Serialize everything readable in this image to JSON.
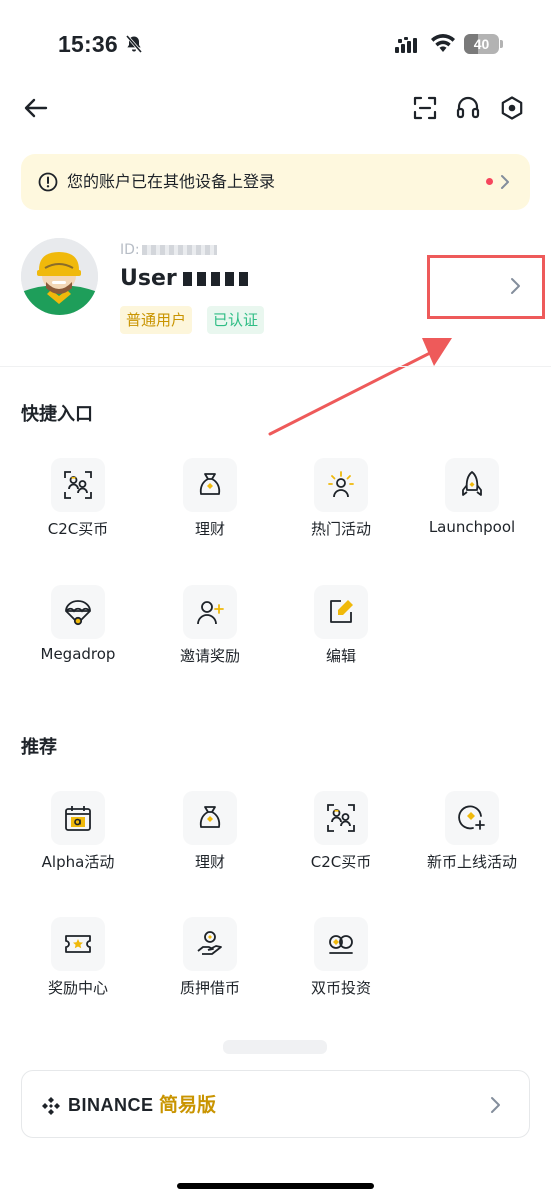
{
  "status_bar": {
    "time": "15:36",
    "battery": "40",
    "battery_level": 0.4
  },
  "header": {
    "back_icon": "arrow-left-icon",
    "scan_icon": "scan-icon",
    "support_icon": "headset-icon",
    "settings_icon": "settings-hexagon-icon"
  },
  "notice": {
    "text": "您的账户已在其他设备上登录"
  },
  "profile": {
    "id_prefix": "ID:",
    "username_prefix": "User",
    "badge_normal": "普通用户",
    "badge_verified": "已认证"
  },
  "quick_access": {
    "title": "快捷入口",
    "items": [
      {
        "label": "C2C买币",
        "icon": "c2c-users-icon"
      },
      {
        "label": "理财",
        "icon": "money-bag-icon"
      },
      {
        "label": "热门活动",
        "icon": "sun-person-icon"
      },
      {
        "label": "Launchpool",
        "icon": "rocket-icon"
      },
      {
        "label": "Megadrop",
        "icon": "parachute-icon"
      },
      {
        "label": "邀请奖励",
        "icon": "add-user-icon"
      },
      {
        "label": "编辑",
        "icon": "edit-icon"
      }
    ]
  },
  "recommended": {
    "title": "推荐",
    "items": [
      {
        "label": "Alpha活动",
        "icon": "calendar-alpha-icon"
      },
      {
        "label": "理财",
        "icon": "money-bag-icon"
      },
      {
        "label": "C2C买币",
        "icon": "c2c-users-icon"
      },
      {
        "label": "新币上线活动",
        "icon": "new-coin-icon"
      },
      {
        "label": "奖励中心",
        "icon": "ticket-star-icon"
      },
      {
        "label": "质押借币",
        "icon": "hand-coin-icon"
      },
      {
        "label": "双币投资",
        "icon": "dual-coin-icon"
      }
    ]
  },
  "lite": {
    "brand": "BINANCE",
    "subtitle": "简易版"
  },
  "colors": {
    "accent": "#c99400",
    "yellow": "#f0b90b",
    "notice_bg": "#fef8de",
    "verified": "#2ebd85",
    "annotation": "#ee5a5a"
  }
}
